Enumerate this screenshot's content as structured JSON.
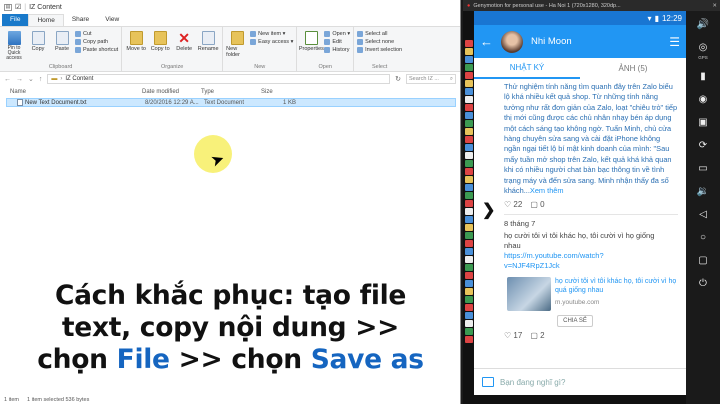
{
  "explorer": {
    "title": "IZ Content",
    "ribbon_tabs": [
      "File",
      "Home",
      "Share",
      "View"
    ],
    "clipboard": {
      "pin": "Pin to Quick access",
      "copy": "Copy",
      "paste": "Paste",
      "cut": "Cut",
      "copy_path": "Copy path",
      "paste_shortcut": "Paste shortcut",
      "group": "Clipboard"
    },
    "organize": {
      "move_to": "Move to",
      "copy_to": "Copy to",
      "delete": "Delete",
      "rename": "Rename",
      "group": "Organize"
    },
    "new": {
      "new_folder": "New folder",
      "new_item": "New item ▾",
      "easy_access": "Easy access ▾",
      "group": "New"
    },
    "open": {
      "properties": "Properties",
      "open": "Open ▾",
      "edit": "Edit",
      "history": "History",
      "group": "Open"
    },
    "select": {
      "select_all": "Select all",
      "select_none": "Select none",
      "invert": "Invert selection",
      "group": "Select"
    },
    "path": [
      "IZ Content"
    ],
    "search_placeholder": "Search IZ ...",
    "columns": {
      "name": "Name",
      "date": "Date modified",
      "type": "Type",
      "size": "Size"
    },
    "files": [
      {
        "name": "New Text Document.txt",
        "date": "8/20/2016 12:29 A...",
        "type": "Text Document",
        "size": "1 KB"
      }
    ],
    "status": {
      "items": "1 item",
      "selected": "1 item selected  536 bytes"
    }
  },
  "overlay": {
    "line1": "Cách khắc phục: tạo file",
    "line2": "text, copy nội dung >>",
    "line3_pre": "chọn ",
    "line3_file": "File",
    "line3_mid": " >> chọn ",
    "line3_save": "Save as"
  },
  "emulator": {
    "title": "Genymotion for personal use - Ha Noi 1 (720x1280, 320dp...",
    "time": "12:29",
    "user": "Nhi Moon",
    "tabs": [
      "NHẬT KÝ",
      "ẢNH (5)"
    ],
    "post_text": "Thử nghiệm tính năng tìm quanh đây trên Zalo biểu lộ khá nhiều kết quả shop. Từ những tính năng tưởng như rất đơn giản của Zalo, loạt \"chiêu trò\" tiếp thị mới cũng được các chủ nhân nhạy bén áp dụng một cách sáng tạo không ngờ. Tuấn Minh, chủ cửa hàng chuyên sửa sang và cài đặt iPhone không ngần ngại tiết lộ bí mật kinh doanh của mình: \"Sau mấy tuần mở shop trên Zalo, kết quả khá khả quan khi có nhiều người chat bàn bạc thông tin về tình trạng máy và đến sửa sang. Minh nhận thấy đa số khách...",
    "post_more": "Xem thêm",
    "likes1": "22",
    "comments1": "0",
    "day": "8 tháng 7",
    "post2_text": "họ cười tôi vì tôi khác họ, tôi cười vì họ giống nhau",
    "post2_link": "https://m.youtube.com/watch?v=NJF4RpZ1Jck",
    "card_text": "họ cười tôi vì tôi khác họ, tôi cười vì họ quá giống nhau",
    "card_domain": "m.youtube.com",
    "share_label": "CHIA SẺ",
    "likes2": "17",
    "comments2": "2",
    "compose_placeholder": "Bạn đang nghĩ gì?",
    "side_labels": {
      "gps": "GPS",
      "battery": "Battery",
      "camera": "Camera",
      "id": "ID"
    }
  }
}
